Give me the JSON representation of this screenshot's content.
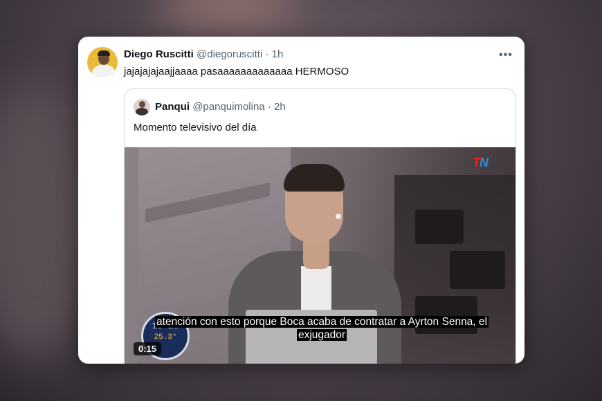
{
  "tweet": {
    "author_name": "Diego Ruscitti",
    "author_handle": "@diegoruscitti",
    "separator": "·",
    "timestamp": "1h",
    "text": "jajajajajaajjaaaa pasaaaaaaaaaaaaa HERMOSO",
    "more_icon": "more-horizontal-icon"
  },
  "quoted_tweet": {
    "author_name": "Panqui",
    "author_handle": "@panquimolina",
    "separator": "·",
    "timestamp": "2h",
    "text": "Momento televisivo del día",
    "video": {
      "subtitle": "atención con esto porque Boca acaba de contratar a Ayrton Senna, el exjugador",
      "duration": "0:15",
      "channel_logo_t": "T",
      "channel_logo_n": "N",
      "clock_time": "13 28",
      "clock_temp": "25.3°"
    }
  },
  "colors": {
    "text_primary": "#0f1419",
    "text_secondary": "#536471",
    "border": "#cfd9de"
  }
}
